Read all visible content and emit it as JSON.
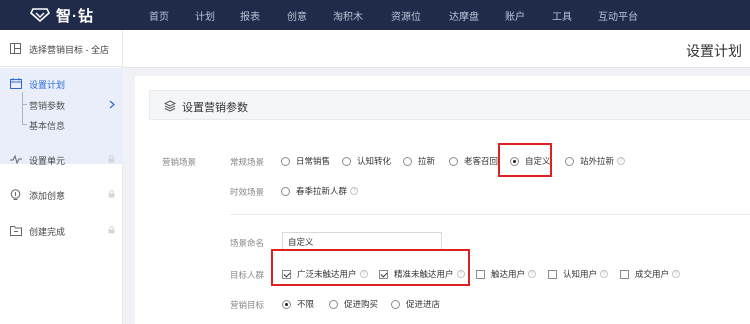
{
  "topbar": {
    "logo_text": "智·钻",
    "nav": [
      "首页",
      "计划",
      "报表",
      "创意",
      "淘积木",
      "资源位",
      "达摩盘",
      "账户",
      "工具",
      "互动平台"
    ]
  },
  "sidebar": {
    "target_label": "选择营销目标 - 全店",
    "items": [
      {
        "label": "设置计划",
        "icon": "calendar-icon"
      },
      {
        "label": "设置单元",
        "icon": "unit-icon"
      },
      {
        "label": "添加创意",
        "icon": "lightbulb-icon"
      },
      {
        "label": "创建完成",
        "icon": "folder-icon"
      }
    ],
    "sub_items": [
      "营销参数",
      "基本信息"
    ]
  },
  "header": {
    "title": "设置计划"
  },
  "section": {
    "title": "设置营销参数"
  },
  "form": {
    "marketing_scene_label": "营销场景",
    "regular_scene_label": "常规场景",
    "regular_options": [
      "日常销售",
      "认知转化",
      "拉新",
      "老客召回",
      "自定义",
      "站外拉新"
    ],
    "regular_selected": "自定义",
    "timely_scene_label": "时效场景",
    "timely_options": [
      "春季拉新人群"
    ],
    "scene_name_label": "场景命名",
    "scene_name_value": "自定义",
    "target_crowd_label": "目标人群",
    "target_crowd_options": [
      {
        "label": "广泛未触达用户",
        "checked": true
      },
      {
        "label": "精准未触达用户",
        "checked": true
      },
      {
        "label": "触达用户",
        "checked": false
      },
      {
        "label": "认知用户",
        "checked": false
      },
      {
        "label": "成交用户",
        "checked": false
      }
    ],
    "marketing_goal_label": "营销目标",
    "marketing_goal_options": [
      "不限",
      "促进购买",
      "促进进店"
    ],
    "marketing_goal_selected": "不限",
    "help_glyph": "?"
  },
  "colors": {
    "topbar": "#1f2b48",
    "highlight": "#e02020",
    "active_bg": "#e9eefa"
  }
}
